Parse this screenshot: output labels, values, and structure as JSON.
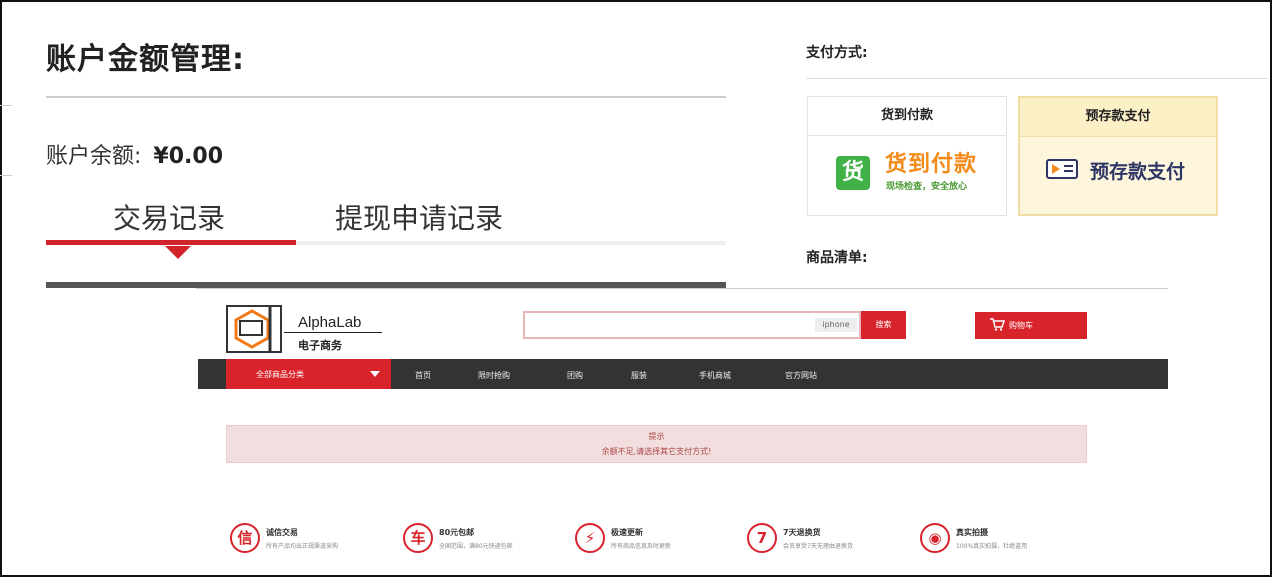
{
  "account": {
    "title": "账户金额管理:",
    "balance_label": "账户余额:",
    "balance_value": "¥0.00",
    "tabs": [
      {
        "label": "交易记录",
        "active": true
      },
      {
        "label": "提现申请记录",
        "active": false
      }
    ]
  },
  "payment": {
    "label": "支付方式:",
    "methods": [
      {
        "header": "货到付款",
        "icon_text": "货",
        "title": "货到付款",
        "subtitle": "现场检查，安全放心"
      },
      {
        "header": "预存款支付",
        "title": "预存款支付",
        "selected": true
      }
    ],
    "goods_label": "商品清单:"
  },
  "shop": {
    "logo_name": "AlphaLab",
    "logo_sub": "电子商务",
    "search": {
      "placeholder": "",
      "hint": "iphone",
      "button": "搜索"
    },
    "cart_label": "购物车",
    "category_label": "全部商品分类",
    "nav": [
      "首页",
      "限时抢购",
      "团购",
      "服装",
      "手机商城",
      "官方网站"
    ],
    "alert": {
      "title": "提示",
      "message": "余额不足,请选择其它支付方式!"
    },
    "features": [
      {
        "icon": "信",
        "title": "诚信交易",
        "desc": "所有产品均出正规渠道采购"
      },
      {
        "icon": "车",
        "title": "80元包邮",
        "desc": "全国范围，满80元快递包邮"
      },
      {
        "icon": "⚡",
        "title": "极速更新",
        "desc": "所有商品信息及时更新"
      },
      {
        "icon": "7",
        "title": "7天退换货",
        "desc": "会员享受7天无理由退换货"
      },
      {
        "icon": "◉",
        "title": "真实拍摄",
        "desc": "100%真实拍摄，杜绝盗用"
      }
    ]
  },
  "colors": {
    "accent_red": "#d0232b",
    "cod_orange": "#f38b1a",
    "cod_green": "#3fb145",
    "prepay_navy": "#2d3566"
  }
}
